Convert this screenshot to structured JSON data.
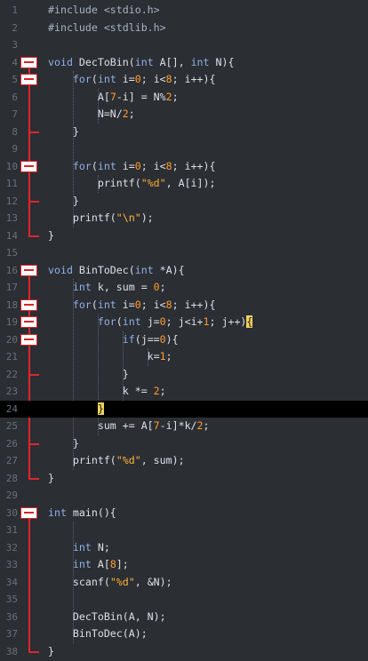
{
  "editor": {
    "colors": {
      "background": "#2b2e33",
      "current_line": "#000000",
      "fold_marker": "#e0252c",
      "line_number": "#6a7077",
      "default_text": "#dde1e6",
      "keyword": "#8fb0e8",
      "number": "#ff9d2e",
      "string": "#ffb437",
      "bracket_match": "#f0d060"
    },
    "current_line": 24,
    "lines": [
      {
        "n": "1",
        "tokens": [
          {
            "t": "#include <stdio.h>",
            "c": "pre"
          }
        ]
      },
      {
        "n": "2",
        "tokens": [
          {
            "t": "#include <stdlib.h>",
            "c": "pre"
          }
        ]
      },
      {
        "n": "3",
        "tokens": []
      },
      {
        "n": "4",
        "tokens": [
          {
            "t": "void ",
            "c": "kw"
          },
          {
            "t": "DecToBin("
          },
          {
            "t": "int ",
            "c": "kw"
          },
          {
            "t": "A[], "
          },
          {
            "t": "int ",
            "c": "kw"
          },
          {
            "t": "N){"
          }
        ]
      },
      {
        "n": "5",
        "tokens": [
          {
            "t": "    "
          },
          {
            "t": "for",
            "c": "kw"
          },
          {
            "t": "("
          },
          {
            "t": "int ",
            "c": "kw"
          },
          {
            "t": "i="
          },
          {
            "t": "0",
            "c": "num"
          },
          {
            "t": "; i<"
          },
          {
            "t": "8",
            "c": "num"
          },
          {
            "t": "; i++){"
          }
        ]
      },
      {
        "n": "6",
        "tokens": [
          {
            "t": "        A["
          },
          {
            "t": "7",
            "c": "num"
          },
          {
            "t": "-i] = N%"
          },
          {
            "t": "2",
            "c": "num"
          },
          {
            "t": ";"
          }
        ]
      },
      {
        "n": "7",
        "tokens": [
          {
            "t": "        N=N/"
          },
          {
            "t": "2",
            "c": "num"
          },
          {
            "t": ";"
          }
        ]
      },
      {
        "n": "8",
        "tokens": [
          {
            "t": "    }"
          }
        ]
      },
      {
        "n": "9",
        "tokens": []
      },
      {
        "n": "10",
        "tokens": [
          {
            "t": "    "
          },
          {
            "t": "for",
            "c": "kw"
          },
          {
            "t": "("
          },
          {
            "t": "int ",
            "c": "kw"
          },
          {
            "t": "i="
          },
          {
            "t": "0",
            "c": "num"
          },
          {
            "t": "; i<"
          },
          {
            "t": "8",
            "c": "num"
          },
          {
            "t": "; i++){"
          }
        ]
      },
      {
        "n": "11",
        "tokens": [
          {
            "t": "        printf("
          },
          {
            "t": "\"%d\"",
            "c": "str"
          },
          {
            "t": ", A[i]);"
          }
        ]
      },
      {
        "n": "12",
        "tokens": [
          {
            "t": "    }"
          }
        ]
      },
      {
        "n": "13",
        "tokens": [
          {
            "t": "    printf("
          },
          {
            "t": "\"\\n\"",
            "c": "str"
          },
          {
            "t": ");"
          }
        ]
      },
      {
        "n": "14",
        "tokens": [
          {
            "t": "}"
          }
        ]
      },
      {
        "n": "15",
        "tokens": []
      },
      {
        "n": "16",
        "tokens": [
          {
            "t": "void ",
            "c": "kw"
          },
          {
            "t": "BinToDec("
          },
          {
            "t": "int ",
            "c": "kw"
          },
          {
            "t": "*A){"
          }
        ]
      },
      {
        "n": "17",
        "tokens": [
          {
            "t": "    "
          },
          {
            "t": "int ",
            "c": "kw"
          },
          {
            "t": "k, sum = "
          },
          {
            "t": "0",
            "c": "num"
          },
          {
            "t": ";"
          }
        ]
      },
      {
        "n": "18",
        "tokens": [
          {
            "t": "    "
          },
          {
            "t": "for",
            "c": "kw"
          },
          {
            "t": "("
          },
          {
            "t": "int ",
            "c": "kw"
          },
          {
            "t": "i="
          },
          {
            "t": "0",
            "c": "num"
          },
          {
            "t": "; i<"
          },
          {
            "t": "8",
            "c": "num"
          },
          {
            "t": "; i++){"
          }
        ]
      },
      {
        "n": "19",
        "tokens": [
          {
            "t": "        "
          },
          {
            "t": "for",
            "c": "kw"
          },
          {
            "t": "("
          },
          {
            "t": "int ",
            "c": "kw"
          },
          {
            "t": "j="
          },
          {
            "t": "0",
            "c": "num"
          },
          {
            "t": "; j<i+"
          },
          {
            "t": "1",
            "c": "num"
          },
          {
            "t": "; j++)"
          },
          {
            "t": "{",
            "c": "br"
          }
        ]
      },
      {
        "n": "20",
        "tokens": [
          {
            "t": "            "
          },
          {
            "t": "if",
            "c": "kw"
          },
          {
            "t": "(j=="
          },
          {
            "t": "0",
            "c": "num"
          },
          {
            "t": "){"
          }
        ]
      },
      {
        "n": "21",
        "tokens": [
          {
            "t": "                k="
          },
          {
            "t": "1",
            "c": "num"
          },
          {
            "t": ";"
          }
        ]
      },
      {
        "n": "22",
        "tokens": [
          {
            "t": "            }"
          }
        ]
      },
      {
        "n": "23",
        "tokens": [
          {
            "t": "            k *= "
          },
          {
            "t": "2",
            "c": "num"
          },
          {
            "t": ";"
          }
        ]
      },
      {
        "n": "24",
        "tokens": [
          {
            "t": "        "
          },
          {
            "t": "}",
            "c": "br"
          }
        ]
      },
      {
        "n": "25",
        "tokens": [
          {
            "t": "        sum += A["
          },
          {
            "t": "7",
            "c": "num"
          },
          {
            "t": "-i]*k/"
          },
          {
            "t": "2",
            "c": "num"
          },
          {
            "t": ";"
          }
        ]
      },
      {
        "n": "26",
        "tokens": [
          {
            "t": "    }"
          }
        ]
      },
      {
        "n": "27",
        "tokens": [
          {
            "t": "    printf("
          },
          {
            "t": "\"%d\"",
            "c": "str"
          },
          {
            "t": ", sum);"
          }
        ]
      },
      {
        "n": "28",
        "tokens": [
          {
            "t": "}"
          }
        ]
      },
      {
        "n": "29",
        "tokens": []
      },
      {
        "n": "30",
        "tokens": [
          {
            "t": "int ",
            "c": "kw"
          },
          {
            "t": "main(){"
          }
        ]
      },
      {
        "n": "31",
        "tokens": []
      },
      {
        "n": "32",
        "tokens": [
          {
            "t": "    "
          },
          {
            "t": "int ",
            "c": "kw"
          },
          {
            "t": "N;"
          }
        ]
      },
      {
        "n": "33",
        "tokens": [
          {
            "t": "    "
          },
          {
            "t": "int ",
            "c": "kw"
          },
          {
            "t": "A["
          },
          {
            "t": "8",
            "c": "num"
          },
          {
            "t": "];"
          }
        ]
      },
      {
        "n": "34",
        "tokens": [
          {
            "t": "    scanf("
          },
          {
            "t": "\"%d\"",
            "c": "str"
          },
          {
            "t": ", &N);"
          }
        ]
      },
      {
        "n": "35",
        "tokens": []
      },
      {
        "n": "36",
        "tokens": [
          {
            "t": "    DecToBin(A, N);"
          }
        ]
      },
      {
        "n": "37",
        "tokens": [
          {
            "t": "    BinToDec(A);"
          }
        ]
      },
      {
        "n": "38",
        "tokens": [
          {
            "t": "}"
          }
        ]
      }
    ],
    "fold_blocks": [
      {
        "start": 4,
        "end": 14
      },
      {
        "start": 5,
        "end": 8
      },
      {
        "start": 10,
        "end": 12
      },
      {
        "start": 16,
        "end": 28
      },
      {
        "start": 18,
        "end": 26
      },
      {
        "start": 19,
        "end": 24
      },
      {
        "start": 20,
        "end": 22
      },
      {
        "start": 30,
        "end": 38
      }
    ],
    "indent_guides": [
      {
        "col": 4,
        "from": 5,
        "to": 13
      },
      {
        "col": 8,
        "from": 6,
        "to": 7
      },
      {
        "col": 8,
        "from": 11,
        "to": 11
      },
      {
        "col": 4,
        "from": 17,
        "to": 27
      },
      {
        "col": 8,
        "from": 19,
        "to": 25
      },
      {
        "col": 12,
        "from": 20,
        "to": 23
      },
      {
        "col": 16,
        "from": 21,
        "to": 21
      },
      {
        "col": 4,
        "from": 31,
        "to": 37
      }
    ]
  }
}
